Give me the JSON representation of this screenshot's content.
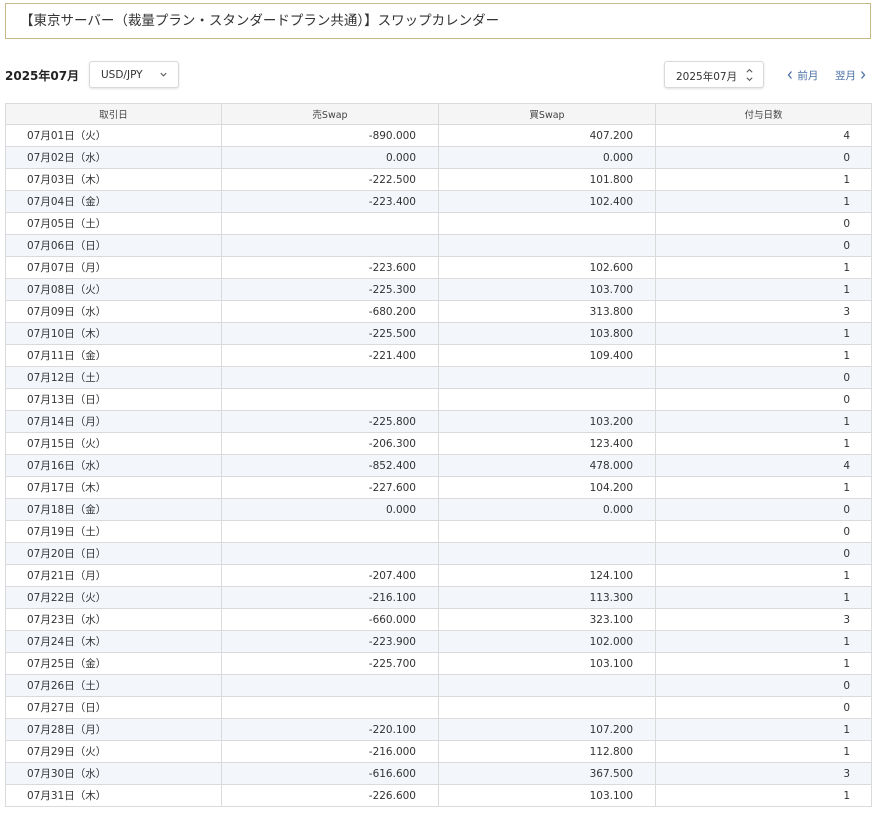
{
  "page": {
    "title": "【東京サーバー（裁量プラン・スタンダードプラン共通）】スワップカレンダー"
  },
  "toolbar": {
    "period_label": "2025年07月",
    "pair_select": {
      "value": "USD/JPY",
      "icon": "chevron-down-icon"
    },
    "month_select": {
      "value": "2025年07月",
      "icon": "up-down-icon"
    },
    "prev_label": "前月",
    "next_label": "翌月"
  },
  "table": {
    "headers": [
      "取引日",
      "売Swap",
      "買Swap",
      "付与日数"
    ],
    "rows": [
      {
        "date": "07月01日（火）",
        "sell": "-890.000",
        "buy": "407.200",
        "days": "4"
      },
      {
        "date": "07月02日（水）",
        "sell": "0.000",
        "buy": "0.000",
        "days": "0"
      },
      {
        "date": "07月03日（木）",
        "sell": "-222.500",
        "buy": "101.800",
        "days": "1"
      },
      {
        "date": "07月04日（金）",
        "sell": "-223.400",
        "buy": "102.400",
        "days": "1"
      },
      {
        "date": "07月05日（土）",
        "sell": "",
        "buy": "",
        "days": "0"
      },
      {
        "date": "07月06日（日）",
        "sell": "",
        "buy": "",
        "days": "0"
      },
      {
        "date": "07月07日（月）",
        "sell": "-223.600",
        "buy": "102.600",
        "days": "1"
      },
      {
        "date": "07月08日（火）",
        "sell": "-225.300",
        "buy": "103.700",
        "days": "1"
      },
      {
        "date": "07月09日（水）",
        "sell": "-680.200",
        "buy": "313.800",
        "days": "3"
      },
      {
        "date": "07月10日（木）",
        "sell": "-225.500",
        "buy": "103.800",
        "days": "1"
      },
      {
        "date": "07月11日（金）",
        "sell": "-221.400",
        "buy": "109.400",
        "days": "1"
      },
      {
        "date": "07月12日（土）",
        "sell": "",
        "buy": "",
        "days": "0"
      },
      {
        "date": "07月13日（日）",
        "sell": "",
        "buy": "",
        "days": "0"
      },
      {
        "date": "07月14日（月）",
        "sell": "-225.800",
        "buy": "103.200",
        "days": "1"
      },
      {
        "date": "07月15日（火）",
        "sell": "-206.300",
        "buy": "123.400",
        "days": "1"
      },
      {
        "date": "07月16日（水）",
        "sell": "-852.400",
        "buy": "478.000",
        "days": "4"
      },
      {
        "date": "07月17日（木）",
        "sell": "-227.600",
        "buy": "104.200",
        "days": "1"
      },
      {
        "date": "07月18日（金）",
        "sell": "0.000",
        "buy": "0.000",
        "days": "0"
      },
      {
        "date": "07月19日（土）",
        "sell": "",
        "buy": "",
        "days": "0"
      },
      {
        "date": "07月20日（日）",
        "sell": "",
        "buy": "",
        "days": "0"
      },
      {
        "date": "07月21日（月）",
        "sell": "-207.400",
        "buy": "124.100",
        "days": "1"
      },
      {
        "date": "07月22日（火）",
        "sell": "-216.100",
        "buy": "113.300",
        "days": "1"
      },
      {
        "date": "07月23日（水）",
        "sell": "-660.000",
        "buy": "323.100",
        "days": "3"
      },
      {
        "date": "07月24日（木）",
        "sell": "-223.900",
        "buy": "102.000",
        "days": "1"
      },
      {
        "date": "07月25日（金）",
        "sell": "-225.700",
        "buy": "103.100",
        "days": "1"
      },
      {
        "date": "07月26日（土）",
        "sell": "",
        "buy": "",
        "days": "0"
      },
      {
        "date": "07月27日（日）",
        "sell": "",
        "buy": "",
        "days": "0"
      },
      {
        "date": "07月28日（月）",
        "sell": "-220.100",
        "buy": "107.200",
        "days": "1"
      },
      {
        "date": "07月29日（火）",
        "sell": "-216.000",
        "buy": "112.800",
        "days": "1"
      },
      {
        "date": "07月30日（水）",
        "sell": "-616.600",
        "buy": "367.500",
        "days": "3"
      },
      {
        "date": "07月31日（木）",
        "sell": "-226.600",
        "buy": "103.100",
        "days": "1"
      }
    ]
  },
  "colors": {
    "title_border": "#c7b98a",
    "link": "#4a6fa5",
    "row_alt_bg": "#f3f7fc",
    "header_bg": "#f5f5f5",
    "grid_line": "#dadada"
  }
}
